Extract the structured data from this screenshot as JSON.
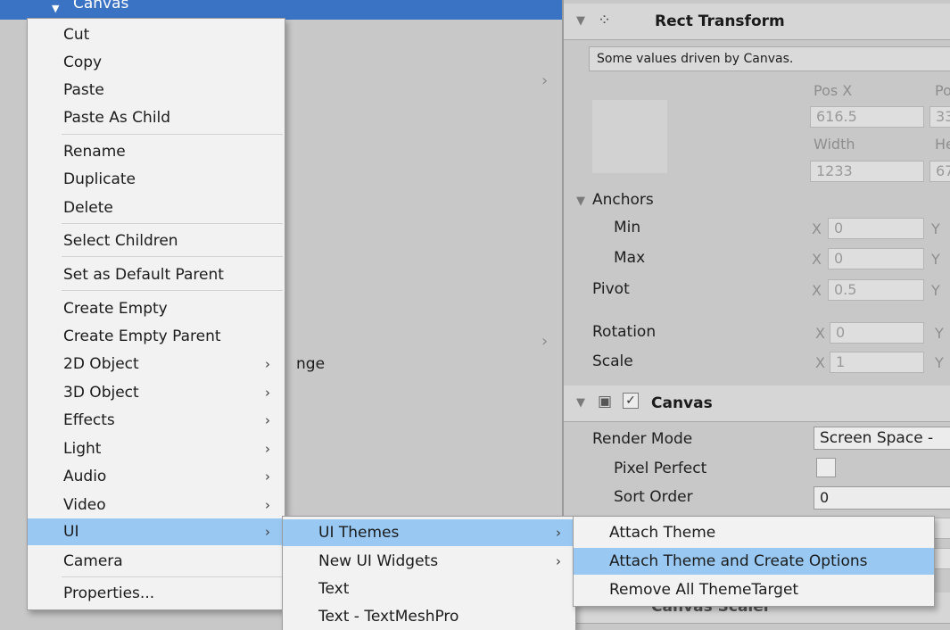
{
  "hierarchy": {
    "selected_item": "Canvas",
    "partial_text": "nge"
  },
  "context_menu": {
    "items": [
      {
        "label": "Cut"
      },
      {
        "label": "Copy"
      },
      {
        "label": "Paste"
      },
      {
        "label": "Paste As Child"
      },
      {
        "label": "Rename"
      },
      {
        "label": "Duplicate"
      },
      {
        "label": "Delete"
      },
      {
        "label": "Select Children"
      },
      {
        "label": "Set as Default Parent"
      },
      {
        "label": "Create Empty"
      },
      {
        "label": "Create Empty Parent"
      },
      {
        "label": "2D Object"
      },
      {
        "label": "3D Object"
      },
      {
        "label": "Effects"
      },
      {
        "label": "Light"
      },
      {
        "label": "Audio"
      },
      {
        "label": "Video"
      },
      {
        "label": "UI"
      },
      {
        "label": "Camera"
      },
      {
        "label": "Properties..."
      }
    ]
  },
  "ui_submenu": {
    "items": [
      {
        "label": "UI Themes"
      },
      {
        "label": "New UI Widgets"
      },
      {
        "label": "Text"
      },
      {
        "label": "Text - TextMeshPro"
      }
    ]
  },
  "themes_submenu": {
    "items": [
      {
        "label": "Attach Theme"
      },
      {
        "label": "Attach Theme and Create Options"
      },
      {
        "label": "Remove All ThemeTarget"
      }
    ]
  },
  "inspector": {
    "rect_transform": {
      "title": "Rect Transform",
      "notice": "Some values driven by Canvas.",
      "pos_x_label": "Pos X",
      "pos_y_label": "Po",
      "pos_x": "616.5",
      "pos_y": "33",
      "width_label": "Width",
      "height_label": "He",
      "width": "1233",
      "height": "67",
      "anchors_label": "Anchors",
      "min_label": "Min",
      "max_label": "Max",
      "pivot_label": "Pivot",
      "rotation_label": "Rotation",
      "scale_label": "Scale",
      "anchor_min_x": "0",
      "anchor_max_x": "0",
      "pivot_x": "0.5",
      "rotation_x": "0",
      "scale_x": "1",
      "x_axis": "X",
      "y_axis": "Y"
    },
    "canvas": {
      "title": "Canvas",
      "render_mode_label": "Render Mode",
      "render_mode_value": "Screen Space -",
      "pixel_perfect_label": "Pixel Perfect",
      "sort_order_label": "Sort Order",
      "sort_order_value": "0"
    },
    "canvas_scaler": {
      "title": "Canvas Scaler"
    }
  },
  "colors": {
    "selection": "#3a72c4",
    "menu_highlight": "#99c9f3",
    "menu_background": "#f2f2f2",
    "panel_background": "#c8c8c8"
  }
}
